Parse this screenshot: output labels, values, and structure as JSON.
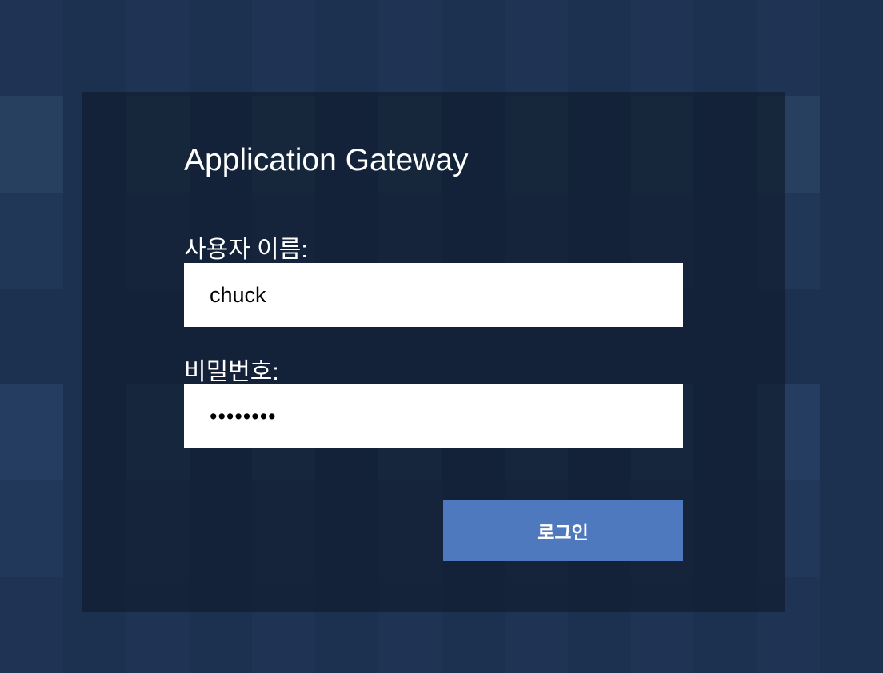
{
  "login": {
    "title": "Application Gateway",
    "username_label": "사용자 이름:",
    "username_value": "chuck",
    "password_label": "비밀번호:",
    "password_value": "••••••••",
    "submit_label": "로그인"
  },
  "colors": {
    "page_background": "#22385a",
    "panel_background": "#131f33",
    "input_background": "#ffffff",
    "button_background": "#4f79bf",
    "text": "#ffffff"
  }
}
